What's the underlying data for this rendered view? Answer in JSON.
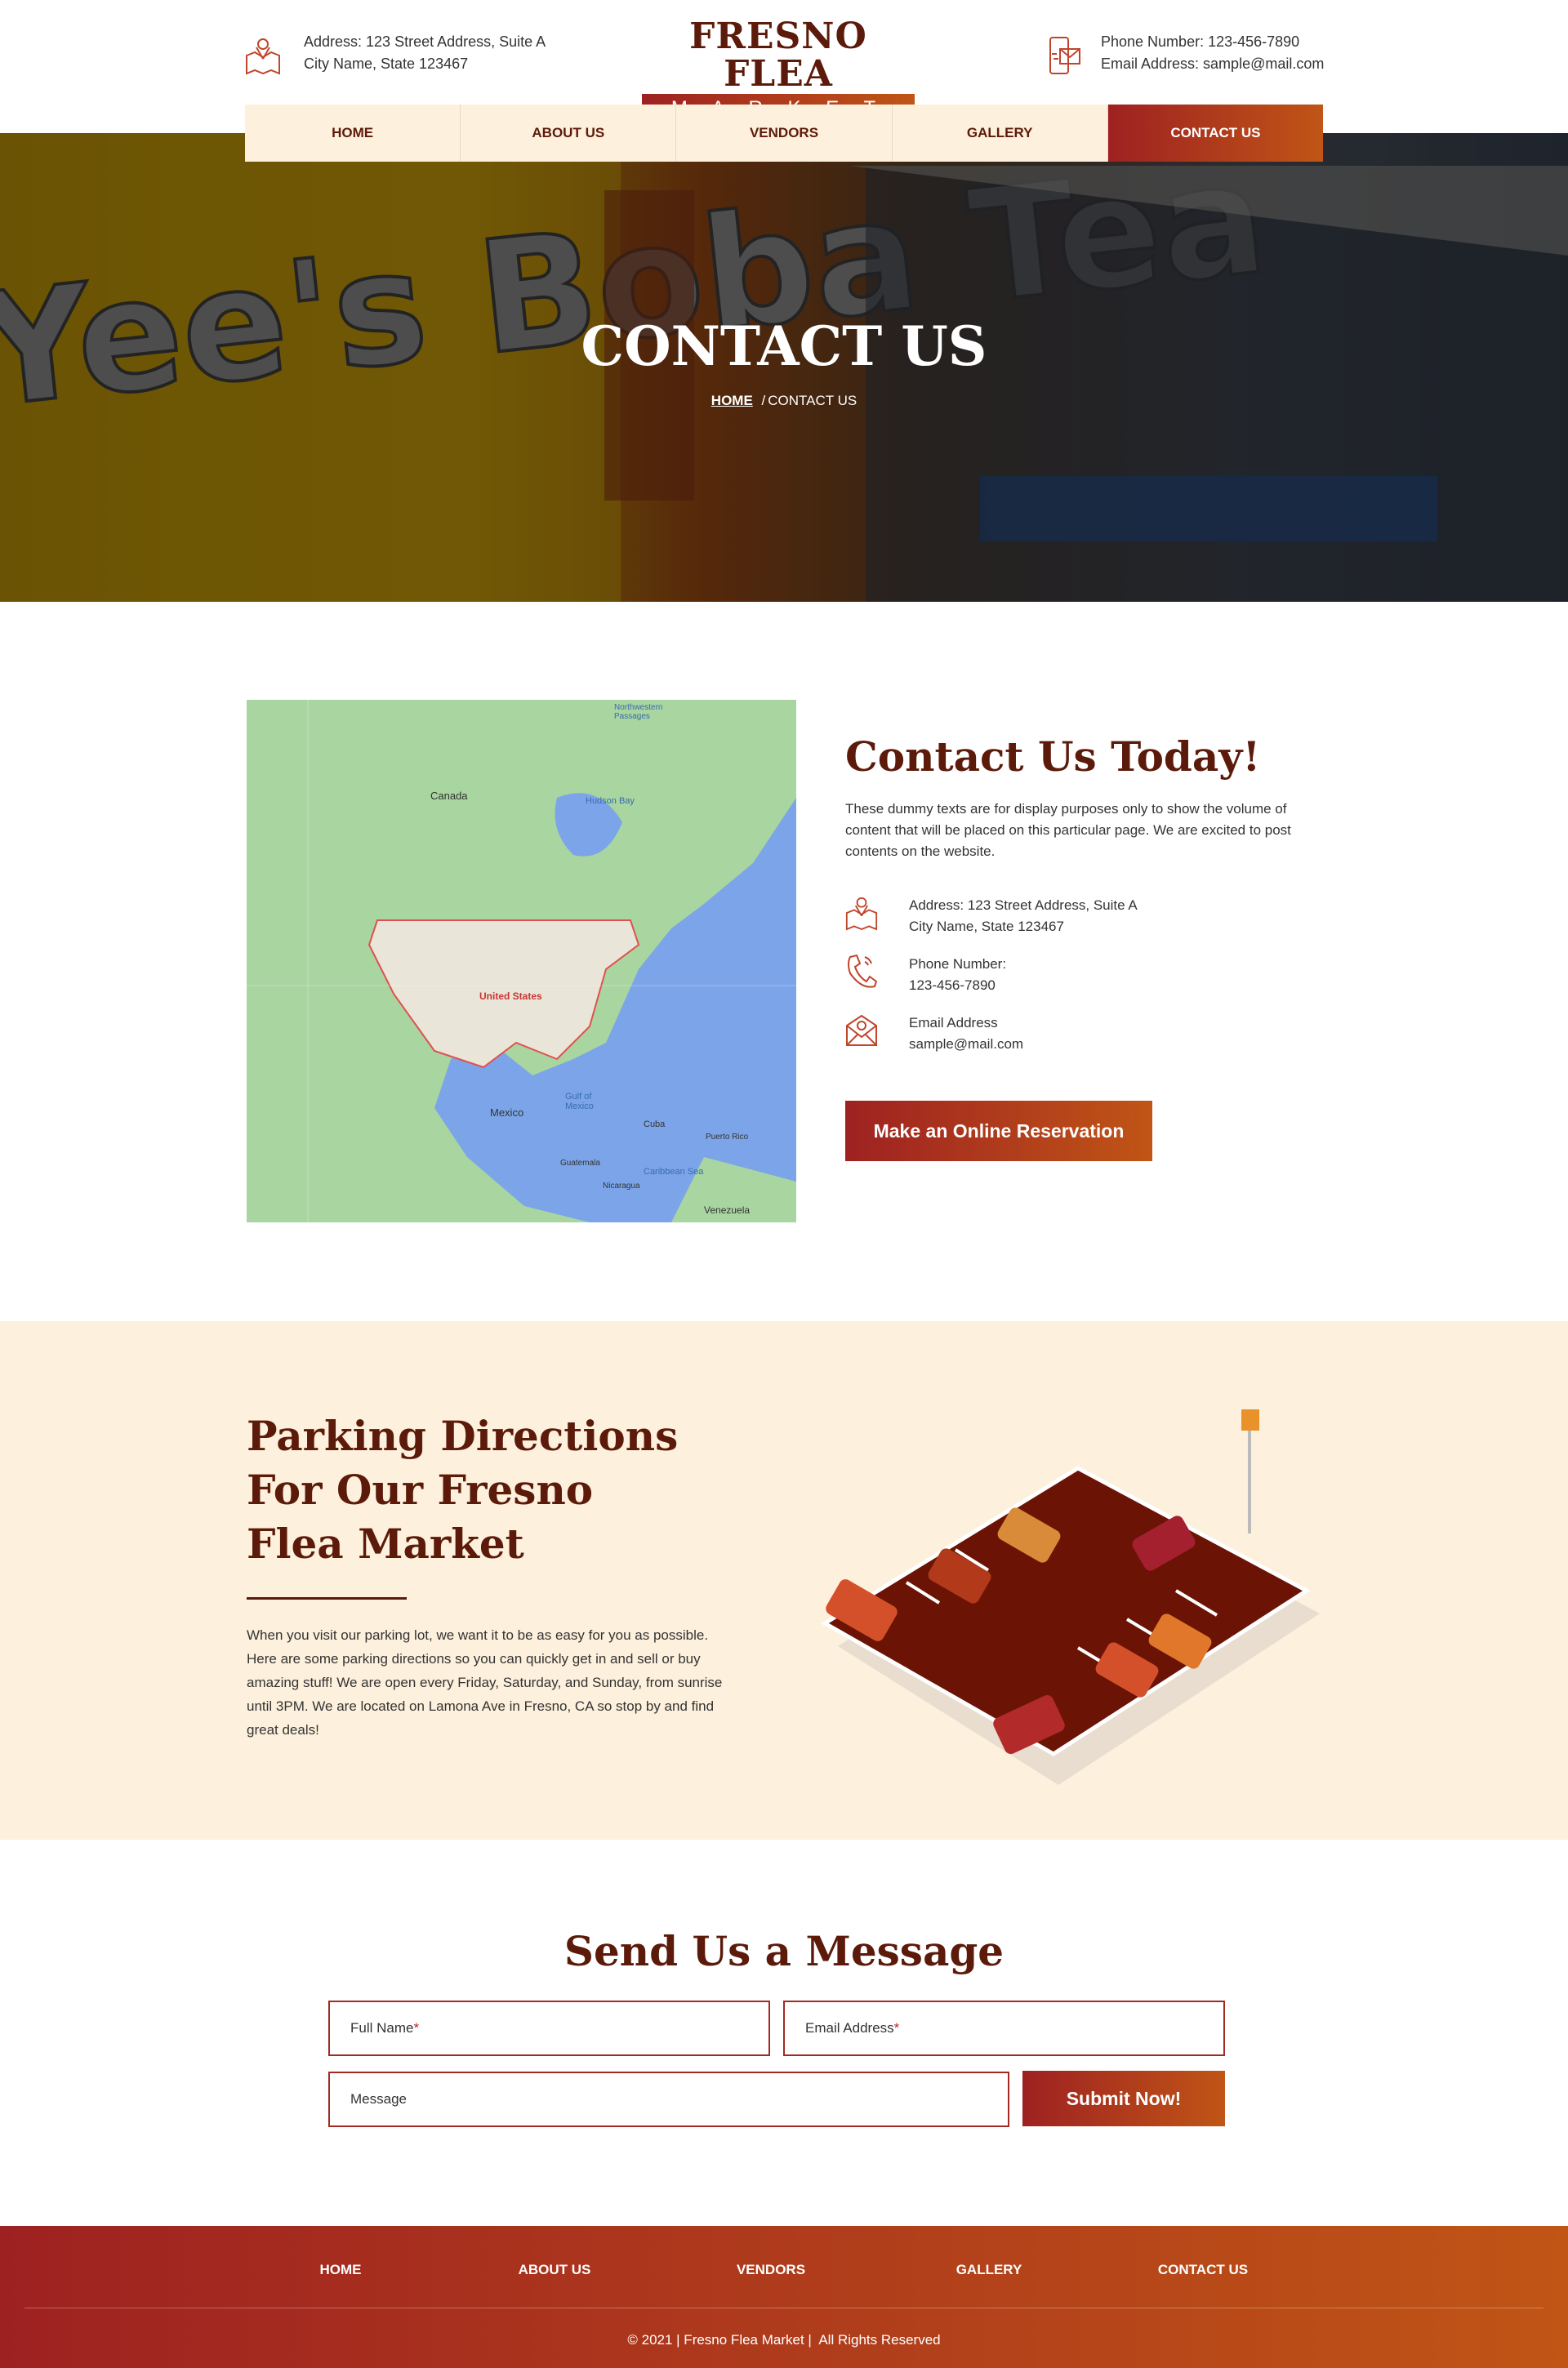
{
  "header": {
    "address_line1": "Address: 123 Street Address, Suite A",
    "address_line2": "City Name, State 123467",
    "logo_top": "FRESNO FLEA",
    "logo_bottom": "M A R K E T",
    "phone": "Phone Number: 123-456-7890",
    "email": "Email Address: sample@mail.com"
  },
  "nav": {
    "items": [
      {
        "label": "HOME"
      },
      {
        "label": "ABOUT US"
      },
      {
        "label": "VENDORS"
      },
      {
        "label": "GALLERY"
      },
      {
        "label": "CONTACT US",
        "active": true
      }
    ]
  },
  "hero": {
    "title": "CONTACT US",
    "breadcrumb_home": "HOME",
    "breadcrumb_sep": "/",
    "breadcrumb_current": "CONTACT US"
  },
  "map": {
    "labels": [
      "Canada",
      "Hudson Bay",
      "United States",
      "Mexico",
      "Gulf of Mexico",
      "Cuba",
      "Puerto Rico",
      "Guatemala",
      "Caribbean Sea",
      "Nicaragua",
      "Venezuela",
      "Northwestern Passages"
    ]
  },
  "contact": {
    "heading": "Contact Us Today!",
    "paragraph": "These dummy texts are for display purposes only to show the volume of content that will be placed on this particular page. We are excited to post contents on the website.",
    "address_line1": "Address: 123 Street Address, Suite A",
    "address_line2": "City Name, State 123467",
    "phone_label": "Phone Number:",
    "phone_value": "123-456-7890",
    "email_label": "Email Address",
    "email_value": "sample@mail.com",
    "reservation_button": "Make an Online Reservation"
  },
  "parking": {
    "heading": "Parking Directions For Our Fresno Flea Market",
    "paragraph": "When you visit our parking lot, we want it to be as easy for you as possible. Here are some parking directions so you can quickly get in and sell or buy amazing stuff! We are open every Friday, Saturday, and Sunday, from sunrise until 3PM. We are located on Lamona Ave in Fresno, CA so stop by and find great deals!"
  },
  "message_form": {
    "heading": "Send Us a Message",
    "full_name_placeholder": "Full Name",
    "email_placeholder": "Email Address",
    "required_mark": "*",
    "message_placeholder": "Message",
    "submit_label": "Submit Now!"
  },
  "footer": {
    "links": [
      "HOME",
      "ABOUT US",
      "VENDORS",
      "GALLERY",
      "CONTACT US"
    ],
    "copyright": "© 2021 | Fresno Flea Market |  All Rights Reserved"
  },
  "colors": {
    "brand_dark": "#5c1a0a",
    "gradient_start": "#9e2121",
    "gradient_end": "#c05516",
    "cream": "#fdf0dc"
  }
}
